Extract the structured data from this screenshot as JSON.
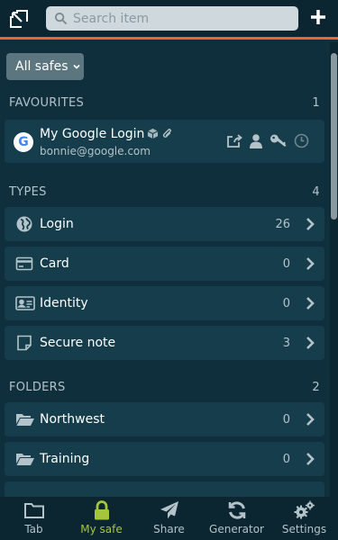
{
  "search": {
    "placeholder": "Search item"
  },
  "safes": {
    "label": "All safes"
  },
  "favourites": {
    "title": "FAVOURITES",
    "count": "1",
    "items": [
      {
        "title": "My Google Login",
        "subtitle": "bonnie@google.com",
        "icon_letter": "G"
      }
    ]
  },
  "types": {
    "title": "TYPES",
    "count": "4",
    "items": [
      {
        "label": "Login",
        "count": "26",
        "icon": "globe-icon"
      },
      {
        "label": "Card",
        "count": "0",
        "icon": "credit-card-icon"
      },
      {
        "label": "Identity",
        "count": "0",
        "icon": "id-card-icon"
      },
      {
        "label": "Secure note",
        "count": "3",
        "icon": "note-icon"
      }
    ]
  },
  "folders": {
    "title": "FOLDERS",
    "count": "2",
    "items": [
      {
        "label": "Northwest",
        "count": "0",
        "icon": "folder-open-icon"
      },
      {
        "label": "Training",
        "count": "0",
        "icon": "folder-open-icon"
      }
    ]
  },
  "tabs": [
    {
      "label": "Tab",
      "icon": "folder-icon"
    },
    {
      "label": "My safe",
      "icon": "lock-icon"
    },
    {
      "label": "Share",
      "icon": "paper-plane-icon"
    },
    {
      "label": "Generator",
      "icon": "refresh-icon"
    },
    {
      "label": "Settings",
      "icon": "gears-icon"
    }
  ],
  "colors": {
    "accent": "#e8692c",
    "active_tab": "#a5c63a",
    "background": "#0f2f3c"
  }
}
